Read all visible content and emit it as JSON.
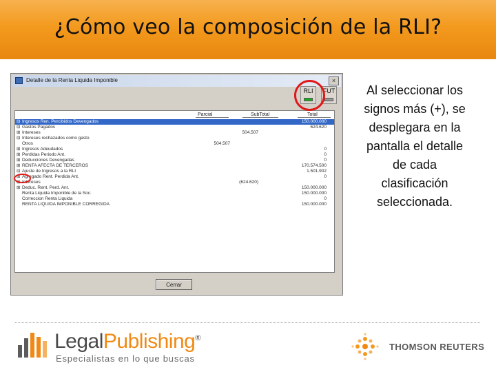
{
  "slide": {
    "title": "¿Cómo veo la composición de la RLI?",
    "side_text": "Al seleccionar los signos más (+), se desplegara en la pantalla el detalle de cada clasificación seleccionada."
  },
  "window": {
    "title": "Detalle de la Renta Liquida Imponible",
    "close_glyph": "×",
    "buttons": {
      "rli": "RLI",
      "fut": "FUT"
    },
    "columns": {
      "parcial": "Parcial",
      "subtotal": "SubTotal",
      "total": "Total"
    },
    "rows": [
      {
        "sign": "⊟",
        "label": "Ingresos Ren. Percibidos Devengados",
        "parcial": "",
        "subtotal": "",
        "total": "150.000.000",
        "selected": true
      },
      {
        "sign": "⊟",
        "label": "Gastos Pagados",
        "parcial": "",
        "subtotal": "",
        "total": "624.620"
      },
      {
        "sign": "⊞",
        "label": "Intereses",
        "parcial": "",
        "subtotal": "504.507",
        "total": ""
      },
      {
        "sign": "⊟",
        "label": "Intereses rechazados como gasto",
        "parcial": "",
        "subtotal": "",
        "total": ""
      },
      {
        "sign": "",
        "label": "Otros",
        "parcial": "504.507",
        "subtotal": "",
        "total": ""
      },
      {
        "sign": "⊞",
        "label": "Ingresos Adeudados",
        "parcial": "",
        "subtotal": "",
        "total": "0"
      },
      {
        "sign": "⊞",
        "label": "Perdidas Periodo Ant.",
        "parcial": "",
        "subtotal": "",
        "total": "0"
      },
      {
        "sign": "⊞",
        "label": "Deducciones Devengadas",
        "parcial": "",
        "subtotal": "",
        "total": "0"
      },
      {
        "sign": "⊞",
        "label": "RENTA AFECTA DE TERCEROS",
        "parcial": "",
        "subtotal": "",
        "total": "170.574.500"
      },
      {
        "sign": "⊟",
        "label": "Ajuste de Ingresos a la RLI",
        "parcial": "",
        "subtotal": "",
        "total": "1.501.902"
      },
      {
        "sign": "⊞",
        "label": "Agregado Rent. Perdida Ant.",
        "parcial": "",
        "subtotal": "",
        "total": "0"
      },
      {
        "sign": "⊞",
        "label": "Intereses",
        "parcial": "",
        "subtotal": "(624.620)",
        "total": ""
      },
      {
        "sign": "⊞",
        "label": "Deduc. Rent. Perd. Ant.",
        "parcial": "",
        "subtotal": "",
        "total": "150.000.000"
      },
      {
        "sign": "",
        "label": "Renta Liquida Imponible de la Soc.",
        "parcial": "",
        "subtotal": "",
        "total": "150.000.000"
      },
      {
        "sign": "",
        "label": "Correccion Renta Liquida",
        "parcial": "",
        "subtotal": "",
        "total": "0"
      },
      {
        "sign": "",
        "label": "RENTA LIQUIDA IMPONIBLE CORREGIDA",
        "parcial": "",
        "subtotal": "",
        "total": "150.000.000"
      }
    ],
    "cancel_label": "Cerrar"
  },
  "footer": {
    "legal_brand_a": "Legal",
    "legal_brand_b": "Publishing",
    "legal_reg": "®",
    "legal_tagline": "Especialistas en lo que buscas",
    "thomson_name": "THOMSON REUTERS"
  },
  "colors": {
    "title_band": "#f39a1e",
    "selection": "#3267c8",
    "highlight_ring": "#e01818",
    "brand_orange": "#f08a14"
  }
}
